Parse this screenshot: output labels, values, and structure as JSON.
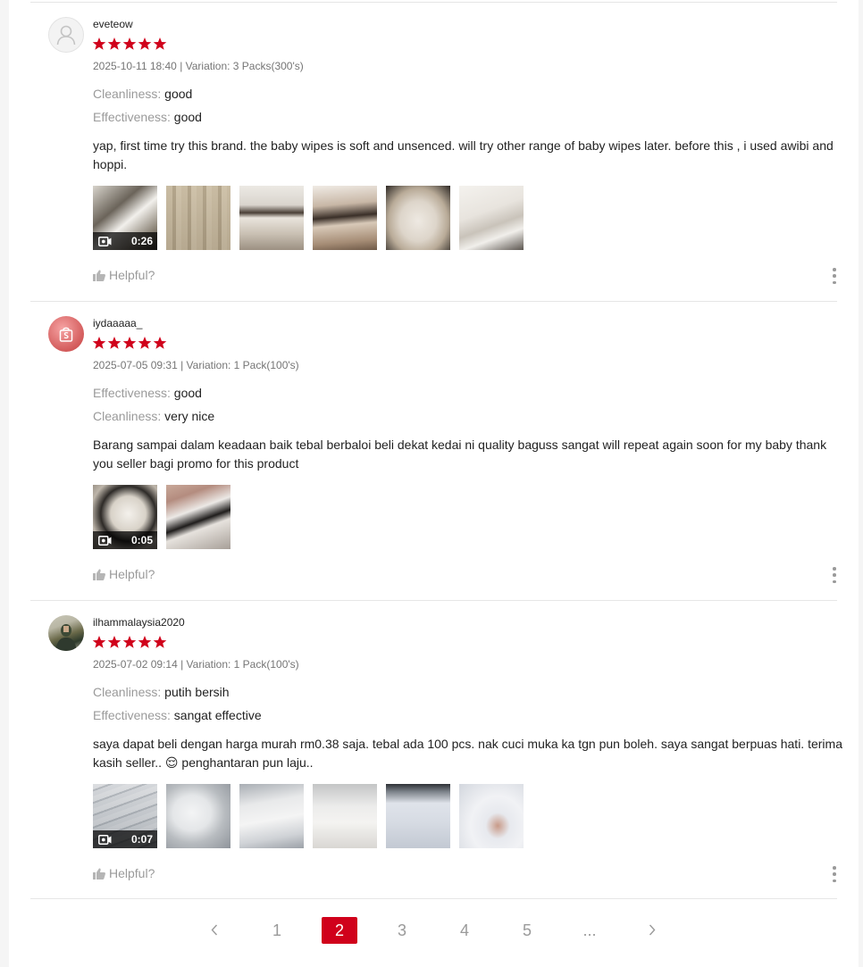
{
  "reviews": [
    {
      "username": "eveteow",
      "rating": 5,
      "meta": "2025-10-11 18:40 | Variation: 3 Packs(300's)",
      "attributes": [
        {
          "key": "Cleanliness:",
          "value": "good"
        },
        {
          "key": "Effectiveness:",
          "value": "good"
        }
      ],
      "comment": "yap, first time try this brand. the baby wipes is soft and unsenced. will try other range of baby wipes later. before this , i used awibi and hoppi.",
      "video_duration": "0:26",
      "helpful_label": "Helpful?",
      "avatar_icon": "default-user-icon"
    },
    {
      "username": "iydaaaaa_",
      "rating": 5,
      "meta": "2025-07-05 09:31 | Variation: 1 Pack(100's)",
      "attributes": [
        {
          "key": "Effectiveness:",
          "value": "good"
        },
        {
          "key": "Cleanliness:",
          "value": "very nice"
        }
      ],
      "comment": "Barang sampai dalam keadaan baik tebal berbaloi beli dekat kedai ni quality baguss sangat will repeat again soon for my baby thank you seller bagi promo for this product",
      "video_duration": "0:05",
      "helpful_label": "Helpful?",
      "avatar_icon": "shopee-bag-icon"
    },
    {
      "username": "ilhammalaysia2020",
      "rating": 5,
      "meta": "2025-07-02 09:14 | Variation: 1 Pack(100's)",
      "attributes": [
        {
          "key": "Cleanliness:",
          "value": "putih bersih"
        },
        {
          "key": "Effectiveness:",
          "value": "sangat effective"
        }
      ],
      "comment": "saya dapat beli dengan harga murah rm0.38 saja. tebal ada 100 pcs. nak cuci muka ka tgn pun boleh. saya sangat berpuas hati. terima kasih seller.. 😌 penghantaran pun laju..",
      "video_duration": "0:07",
      "helpful_label": "Helpful?",
      "avatar_icon": "user-photo"
    }
  ],
  "pagination": {
    "pages": [
      "1",
      "2",
      "3",
      "4",
      "5",
      "..."
    ],
    "current": "2",
    "prev_icon": "chevron-left-icon",
    "next_icon": "chevron-right-icon"
  },
  "colors": {
    "accent": "#d0011b",
    "star": "#d0011b",
    "muted_text": "#9a9a9a"
  }
}
